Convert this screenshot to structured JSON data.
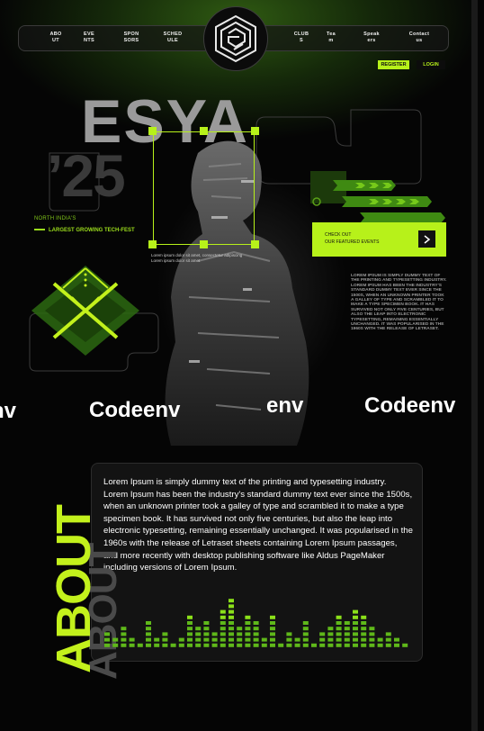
{
  "nav": {
    "items": [
      {
        "label": "ABO\nUT"
      },
      {
        "label": "EVE\nNTS"
      },
      {
        "label": "SPON\nSORS"
      },
      {
        "label": "SCHED\nULE"
      },
      {
        "label": "CLUB\nS"
      },
      {
        "label": "Tea\nm"
      },
      {
        "label": "Speak\ners"
      },
      {
        "label": "Contact\nus"
      }
    ],
    "register_label": "REGISTER",
    "login_label": "LOGIN"
  },
  "hero": {
    "title": "ESYA",
    "year": "’25",
    "tagline_small": "NORTH INDIA'S",
    "tagline_main": "LARGEST GROWING TECH-FEST",
    "caption": "Lorem ipsum dolor sit amet, consectetur adipiscing\nLorem ipsum dolor sit amet",
    "cta_line1": "CHECK OUT",
    "cta_line2": "OUR FEATURED EVENTS",
    "side_text": "LOREM IPSUM IS SIMPLY DUMMY TEXT OF THE PRINTING AND TYPESETTING INDUSTRY. LOREM IPSUM HAS BEEN THE INDUSTRY'S STANDARD DUMMY TEXT EVER SINCE THE 1500S, WHEN AN UNKNOWN PRINTER TOOK A GALLEY OF TYPE AND SCRAMBLED IT TO MAKE A TYPE SPECIMEN BOOK. IT HAS SURVIVED NOT ONLY FIVE CENTURIES, BUT ALSO THE LEAP INTO ELECTRONIC TYPESETTING, REMAINING ESSENTIALLY UNCHANGED. IT WAS POPULARISED IN THE 1960S WITH THE RELEASE OF LETRASET."
  },
  "marquee": [
    "nv",
    "Codeenv",
    "env",
    "Codeenv"
  ],
  "about": {
    "heading": "ABOUT",
    "body": "Lorem Ipsum is simply dummy text of the printing and typesetting industry. Lorem Ipsum has been the industry's standard dummy text ever since the 1500s, when an unknown printer took a galley of type and scrambled it to make a type specimen book. It has survived not only five centuries, but also the leap into electronic typesetting, remaining essentially unchanged. It was popularised in the 1960s with the release of Letraset sheets containing Lorem Ipsum passages, and more recently with desktop publishing software like Aldus PageMaker including versions of Lorem Ipsum.",
    "equalizer_levels": [
      3,
      2,
      4,
      2,
      1,
      5,
      2,
      3,
      1,
      2,
      6,
      4,
      5,
      3,
      7,
      9,
      4,
      6,
      5,
      2,
      6,
      1,
      3,
      2,
      5,
      1,
      3,
      4,
      6,
      5,
      7,
      6,
      4,
      2,
      3,
      2,
      1
    ]
  },
  "colors": {
    "accent": "#b7f11a",
    "background": "#050505"
  }
}
